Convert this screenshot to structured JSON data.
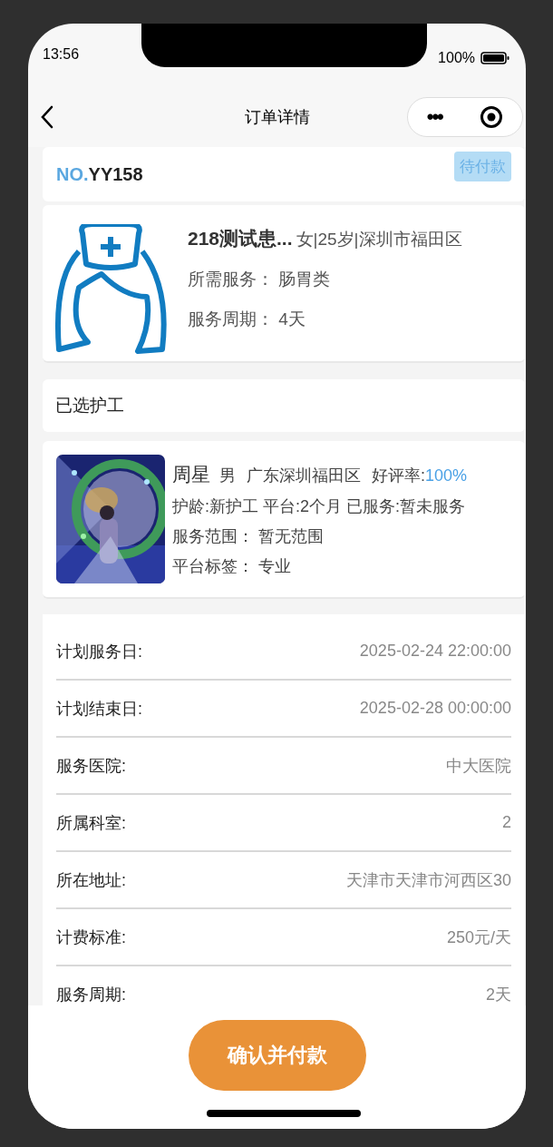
{
  "status_bar": {
    "time": "13:56",
    "battery": "100%"
  },
  "nav": {
    "title": "订单详情",
    "menu": "•••"
  },
  "order": {
    "prefix": "NO.",
    "number": "YY158",
    "status": "待付款"
  },
  "patient": {
    "name": "218测试患...",
    "info": "女|25岁|深圳市福田区",
    "lines": [
      {
        "label": "所需服务：",
        "value": "肠胃类"
      },
      {
        "label": "服务周期：",
        "value": "4天"
      }
    ]
  },
  "section_title": "已选护工",
  "caregiver": {
    "name": "周星",
    "gender": "男",
    "area": "广东深圳福田区",
    "rating_label": "好评率:",
    "rating": "100%",
    "stats": "护龄:新护工 平台:2个月 已服务:暂未服务",
    "lines": [
      {
        "label": "服务范围：",
        "value": "暂无范围"
      },
      {
        "label": "平台标签：",
        "value": "专业"
      }
    ]
  },
  "details": [
    {
      "label": "计划服务日:",
      "value": "2025-02-24 22:00:00"
    },
    {
      "label": "计划结束日:",
      "value": "2025-02-28 00:00:00"
    },
    {
      "label": "服务医院:",
      "value": "中大医院"
    },
    {
      "label": "所属科室:",
      "value": "2"
    },
    {
      "label": "所在地址:",
      "value": "天津市天津市河西区30"
    },
    {
      "label": "计费标准:",
      "value": "250元/天"
    },
    {
      "label": "服务周期:",
      "value": "2天"
    }
  ],
  "confirm_button": "确认并付款"
}
